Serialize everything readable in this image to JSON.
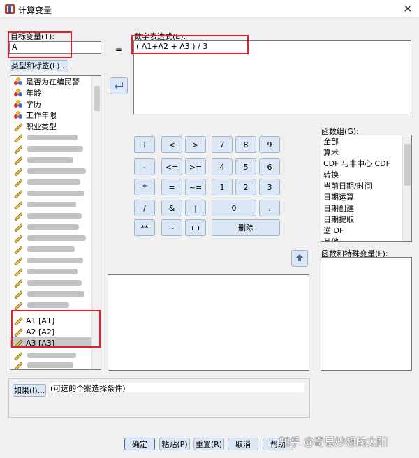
{
  "window": {
    "title": "计算变量",
    "close_glyph": "✕"
  },
  "target": {
    "label": "目标变量(T):",
    "value": "A",
    "type_label_button": "类型和标签(L)..."
  },
  "equals": "=",
  "expression": {
    "label": "数字表达式(E):",
    "value": "( A1+A2 + A3 ) / 3"
  },
  "variables": {
    "visible_items": [
      {
        "label": "是否为在编民警",
        "icon": "nominal-icon"
      },
      {
        "label": "年龄",
        "icon": "nominal-icon"
      },
      {
        "label": "学历",
        "icon": "nominal-icon"
      },
      {
        "label": "工作年限",
        "icon": "nominal-icon"
      },
      {
        "label": "职业类型",
        "icon": "scale-icon"
      }
    ],
    "highlighted_items": [
      {
        "label": "A1 [A1]",
        "icon": "scale-icon"
      },
      {
        "label": "A2 [A2]",
        "icon": "scale-icon"
      },
      {
        "label": "A3 [A3]",
        "icon": "scale-icon"
      }
    ]
  },
  "keypad": {
    "row1": [
      "+",
      "<",
      ">",
      "7",
      "8",
      "9"
    ],
    "row2": [
      "-",
      "<=",
      ">=",
      "4",
      "5",
      "6"
    ],
    "row3": [
      "*",
      "=",
      "~=",
      "1",
      "2",
      "3"
    ],
    "row4": [
      "/",
      "&",
      "|",
      "0",
      "."
    ],
    "row5": [
      "**",
      "~",
      "( )",
      "删除"
    ]
  },
  "function_groups": {
    "label": "函数组(G):",
    "items": [
      "全部",
      "算术",
      "CDF 与非中心 CDF",
      "转换",
      "当前日期/时间",
      "日期运算",
      "日期创建",
      "日期提取",
      "逆 DF",
      "其他"
    ]
  },
  "functions": {
    "label": "函数和特殊变量(F):"
  },
  "condition": {
    "button": "如果(I)...",
    "text": "(可选的个案选择条件)"
  },
  "footer": {
    "ok": "确定",
    "paste": "粘贴(P)",
    "reset": "重置(R)",
    "cancel": "取消",
    "help": "帮助"
  },
  "watermark": "知乎 @奇思妙想的太阳",
  "colors": {
    "highlight": "#e0202a",
    "selection": "#c8c8c8",
    "button_blue": "#dbe7f4"
  }
}
